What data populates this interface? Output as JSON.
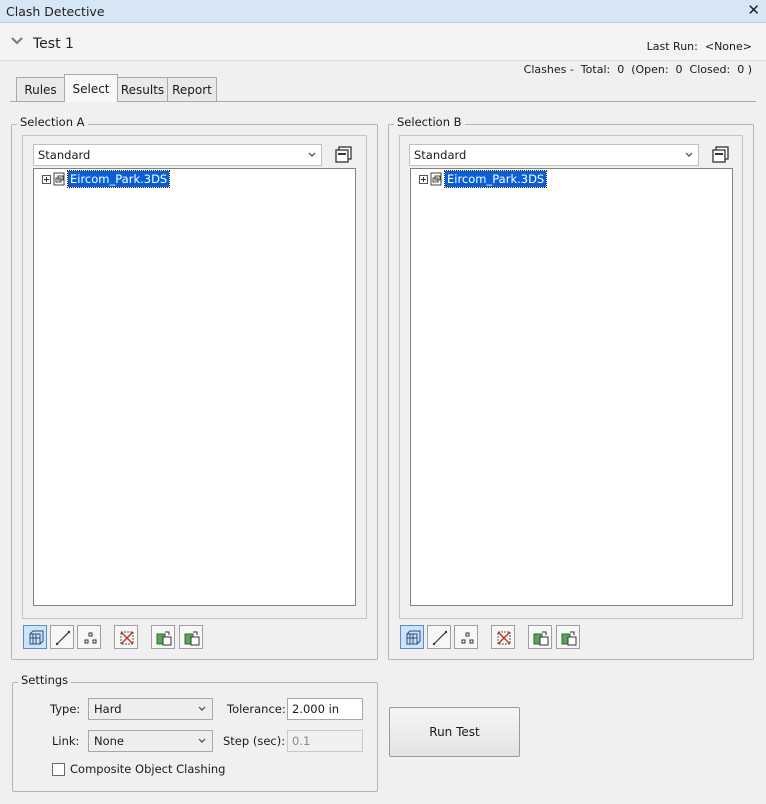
{
  "window": {
    "title": "Clash Detective",
    "close_glyph": "✕"
  },
  "test": {
    "name": "Test 1",
    "last_run_label": "Last Run:",
    "last_run_value": "<None>",
    "clashes_summary": "Clashes -  Total:  0  (Open:  0  Closed:  0 )"
  },
  "tabs": [
    {
      "label": "Rules",
      "active": false
    },
    {
      "label": "Select",
      "active": true
    },
    {
      "label": "Results",
      "active": false
    },
    {
      "label": "Report",
      "active": false
    }
  ],
  "selection_a": {
    "title": "Selection A",
    "dropdown_value": "Standard",
    "tree_item": "Eircom_Park.3DS",
    "buttons": [
      {
        "name": "surfaces-icon",
        "pressed": true
      },
      {
        "name": "lines-icon",
        "pressed": false
      },
      {
        "name": "points-icon",
        "pressed": false
      },
      {
        "name": "self-intersect-icon",
        "pressed": false
      },
      {
        "name": "use-current-selection-icon",
        "pressed": false
      },
      {
        "name": "select-in-scene-icon",
        "pressed": false
      }
    ]
  },
  "selection_b": {
    "title": "Selection B",
    "dropdown_value": "Standard",
    "tree_item": "Eircom_Park.3DS",
    "buttons": [
      {
        "name": "surfaces-icon",
        "pressed": true
      },
      {
        "name": "lines-icon",
        "pressed": false
      },
      {
        "name": "points-icon",
        "pressed": false
      },
      {
        "name": "self-intersect-icon",
        "pressed": false
      },
      {
        "name": "use-current-selection-icon",
        "pressed": false
      },
      {
        "name": "select-in-scene-icon",
        "pressed": false
      }
    ]
  },
  "settings": {
    "title": "Settings",
    "type_label": "Type:",
    "type_value": "Hard",
    "tolerance_label": "Tolerance:",
    "tolerance_value": "2.000 in",
    "link_label": "Link:",
    "link_value": "None",
    "step_label": "Step (sec):",
    "step_value": "0.1",
    "composite_label": "Composite Object Clashing",
    "composite_checked": false
  },
  "run_button": "Run Test",
  "colors": {
    "titlebar": "#d7e6f4",
    "selection_highlight": "#0a5fd6",
    "pressed_button": "#cfe3f8"
  }
}
